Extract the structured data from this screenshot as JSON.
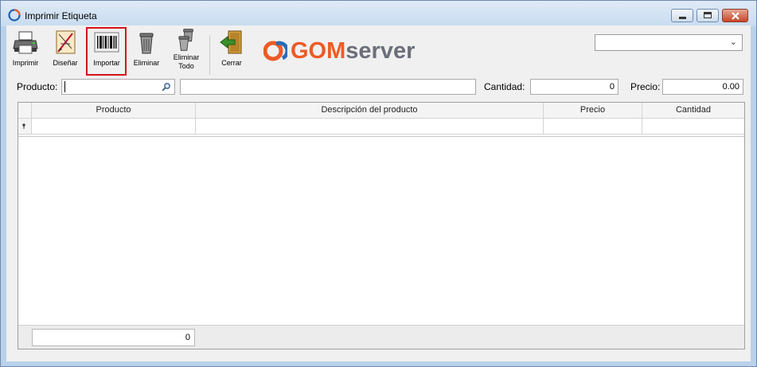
{
  "window": {
    "title": "Imprimir Etiqueta",
    "buttons": {
      "minimize": "minimize-icon",
      "maximize": "maximize-icon",
      "close": "close-icon"
    }
  },
  "toolbar": {
    "items": [
      {
        "label": "Imprimir",
        "icon": "printer-icon"
      },
      {
        "label": "Diseñar",
        "icon": "design-icon"
      },
      {
        "label": "Importar",
        "icon": "barcode-icon"
      },
      {
        "label": "Eliminar",
        "icon": "trash-icon"
      },
      {
        "label": "Eliminar Todo",
        "icon": "trash-all-icon"
      },
      {
        "label": "Cerrar",
        "icon": "exit-door-icon"
      }
    ],
    "logo": {
      "part1": "GOM",
      "part2": "server"
    },
    "combo": {
      "value": ""
    }
  },
  "fields": {
    "producto": {
      "label": "Producto:",
      "value": ""
    },
    "descripcion": {
      "value": ""
    },
    "cantidad": {
      "label": "Cantidad:",
      "value": "0"
    },
    "precio": {
      "label": "Precio:",
      "value": "0.00"
    }
  },
  "grid": {
    "columns": [
      "Producto",
      "Descripción del producto",
      "Precio",
      "Cantidad"
    ],
    "rows": [],
    "footer_total": "0"
  },
  "colors": {
    "accent": "#ee5a24",
    "highlight": "#d4141c",
    "window_frame": "#b9d1ea"
  }
}
